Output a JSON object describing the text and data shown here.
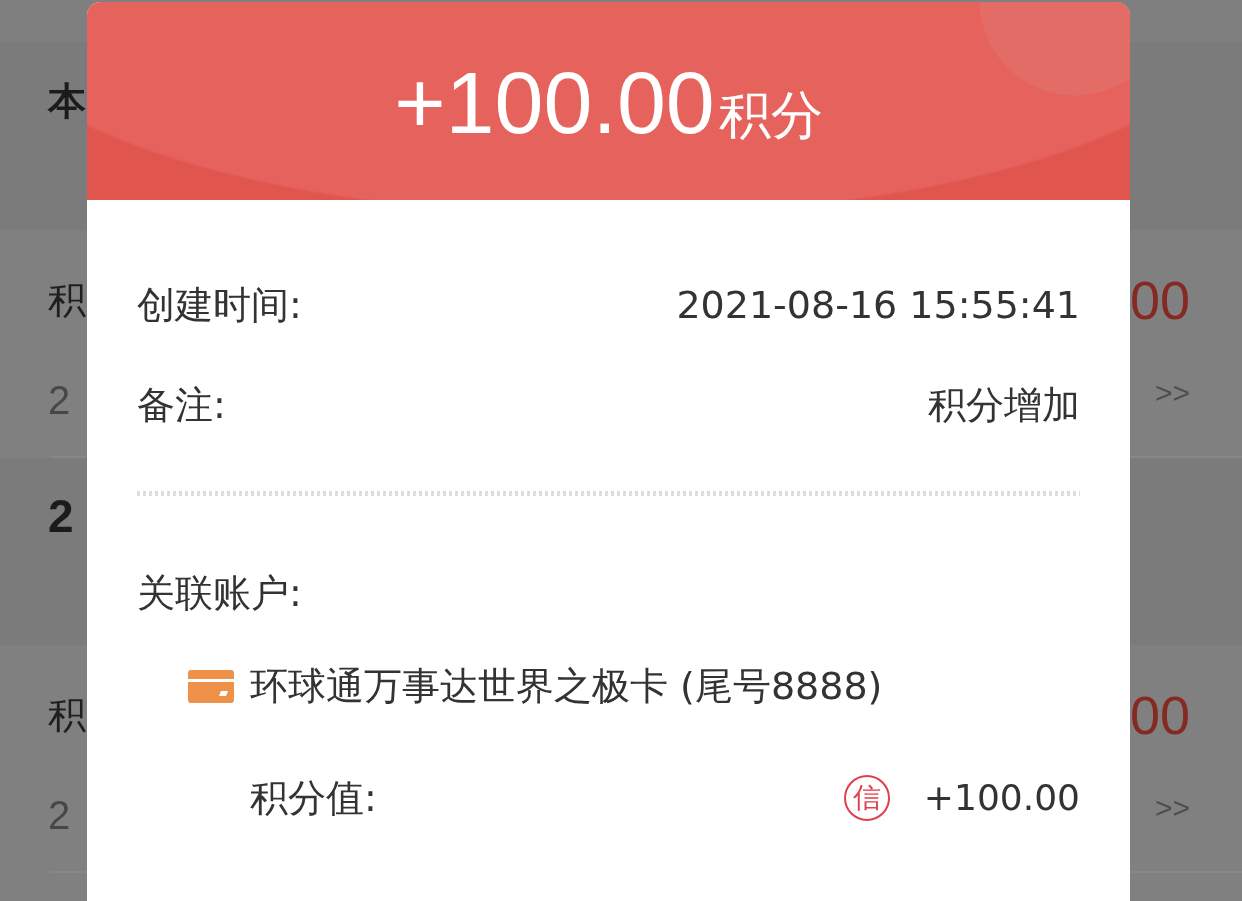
{
  "background": {
    "heading": "本",
    "entries": [
      {
        "kind": "record",
        "title": "积",
        "date": "2",
        "amount": "00",
        "link": ">>"
      },
      {
        "kind": "month",
        "label": "2"
      },
      {
        "kind": "record",
        "title": "积",
        "date": "2",
        "amount": "00",
        "link": ">>"
      }
    ]
  },
  "dialog": {
    "amount": "+100.00",
    "unit": "积分",
    "details": [
      {
        "label": "创建时间:",
        "value": "2021-08-16 15:55:41"
      },
      {
        "label": "备注:",
        "value": "积分增加"
      }
    ],
    "account": {
      "label": "关联账户:",
      "card_name": "环球通万事达世界之极卡 (尾号8888)",
      "points_label": "积分值:",
      "badge": "信",
      "points": "+100.00"
    }
  }
}
